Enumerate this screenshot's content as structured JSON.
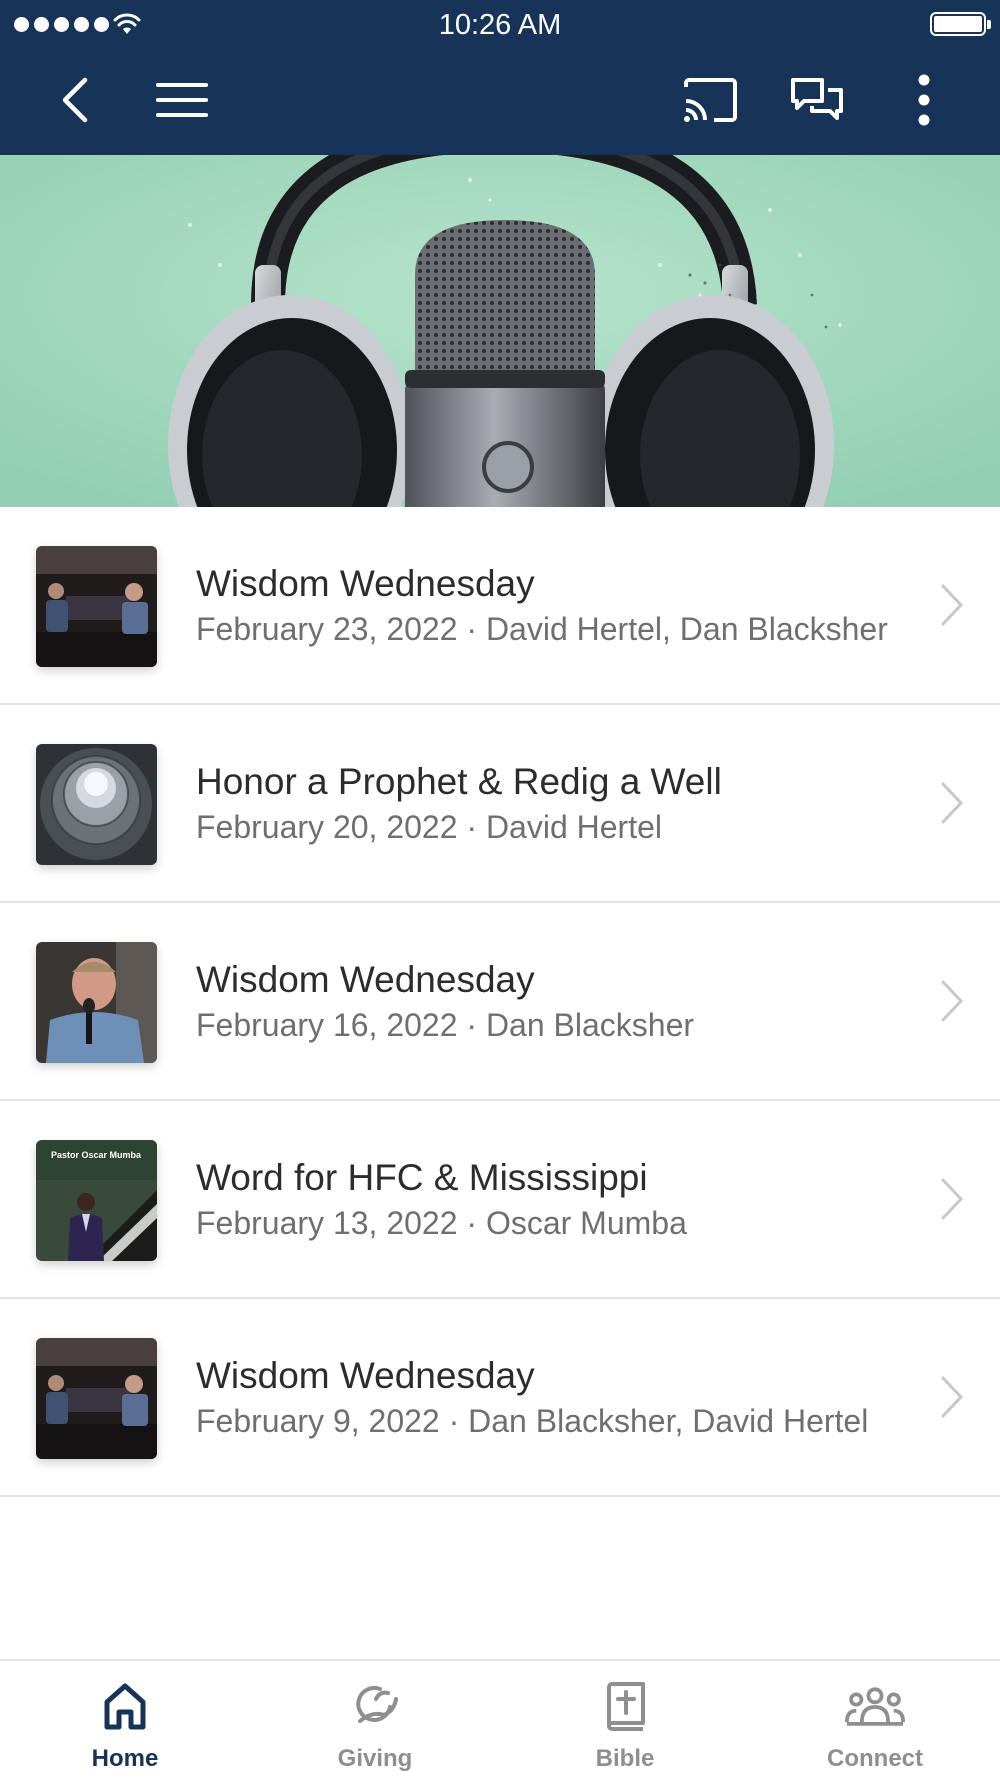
{
  "status_bar": {
    "time": "10:26 AM"
  },
  "nav": {
    "icons": [
      "back-chevron-icon",
      "hamburger-menu-icon",
      "cast-icon",
      "chat-icon",
      "more-vertical-icon"
    ]
  },
  "colors": {
    "nav_background": "#183358",
    "active_tab": "#183358",
    "inactive_tab": "#8e8e93"
  },
  "sermons": [
    {
      "title": "Wisdom Wednesday",
      "subtitle": "February 23, 2022 · David Hertel, Dan Blacksher"
    },
    {
      "title": "Honor a Prophet & Redig a Well",
      "subtitle": "February 20, 2022 · David Hertel"
    },
    {
      "title": "Wisdom Wednesday",
      "subtitle": "February 16, 2022 · Dan Blacksher"
    },
    {
      "title": "Word for HFC & Mississippi",
      "subtitle": "February 13, 2022 · Oscar Mumba"
    },
    {
      "title": "Wisdom Wednesday",
      "subtitle": "February 9, 2022 · Dan Blacksher, David Hertel"
    }
  ],
  "thumb_text": {
    "pastor_card": "Pastor Oscar Mumba"
  },
  "tabs": [
    {
      "label": "Home",
      "icon": "home-icon",
      "active": true
    },
    {
      "label": "Giving",
      "icon": "giving-icon",
      "active": false
    },
    {
      "label": "Bible",
      "icon": "bible-icon",
      "active": false
    },
    {
      "label": "Connect",
      "icon": "people-icon",
      "active": false
    }
  ]
}
